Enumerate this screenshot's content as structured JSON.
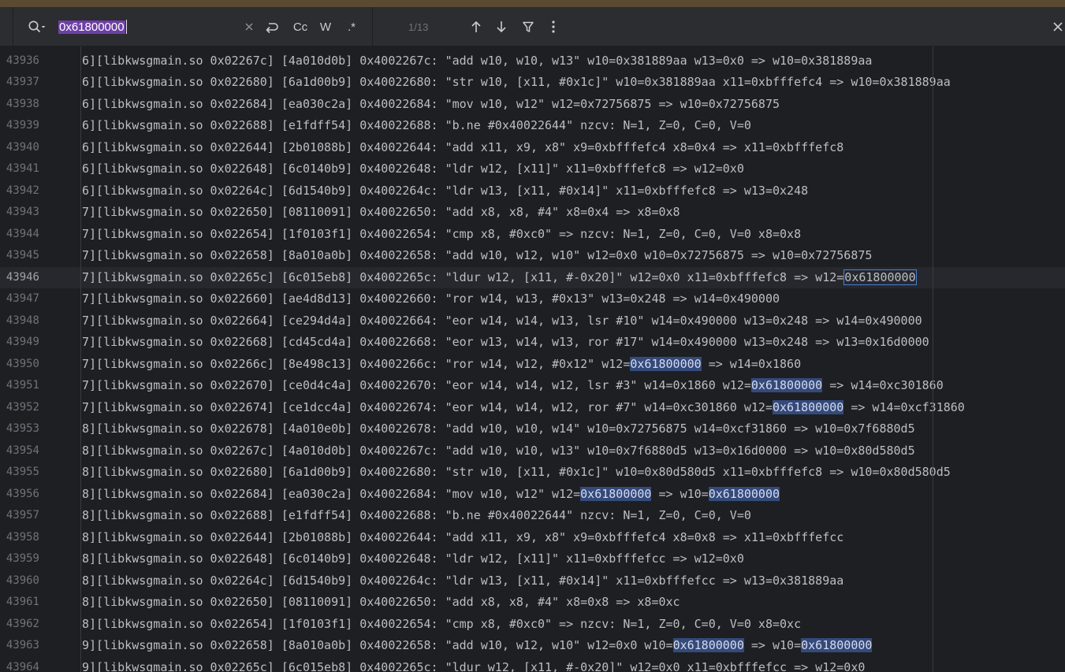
{
  "find_bar": {
    "search_value": "0x61800000",
    "options": {
      "match_case": "Cc",
      "words": "W",
      "regex": ".*"
    },
    "match_counter": "1/13",
    "icons": [
      "search-history-icon",
      "clear-icon",
      "newline-icon",
      "up-arrow-icon",
      "down-arrow-icon",
      "filter-icon",
      "more-options-icon",
      "close-icon"
    ]
  },
  "editor": {
    "current_line": "43946",
    "lines": [
      {
        "no": "43936",
        "segs": [
          {
            "t": "6][libkwsgmain.so 0x02267c] [4a010d0b] 0x4002267c: \"add w10, w10, w13\" w10=0x381889aa w13=0x0 => w10=0x381889aa"
          }
        ]
      },
      {
        "no": "43937",
        "segs": [
          {
            "t": "6][libkwsgmain.so 0x022680] [6a1d00b9] 0x40022680: \"str w10, [x11, #0x1c]\" w10=0x381889aa x11=0xbfffefc4 => w10=0x381889aa"
          }
        ]
      },
      {
        "no": "43938",
        "segs": [
          {
            "t": "6][libkwsgmain.so 0x022684] [ea030c2a] 0x40022684: \"mov w10, w12\" w12=0x72756875 => w10=0x72756875"
          }
        ]
      },
      {
        "no": "43939",
        "segs": [
          {
            "t": "6][libkwsgmain.so 0x022688] [e1fdff54] 0x40022688: \"b.ne #0x40022644\" nzcv: N=1, Z=0, C=0, V=0"
          }
        ]
      },
      {
        "no": "43940",
        "segs": [
          {
            "t": "6][libkwsgmain.so 0x022644] [2b01088b] 0x40022644: \"add x11, x9, x8\" x9=0xbfffefc4 x8=0x4 => x11=0xbfffefc8"
          }
        ]
      },
      {
        "no": "43941",
        "segs": [
          {
            "t": "6][libkwsgmain.so 0x022648] [6c0140b9] 0x40022648: \"ldr w12, [x11]\" x11=0xbfffefc8 => w12=0x0"
          }
        ]
      },
      {
        "no": "43942",
        "segs": [
          {
            "t": "6][libkwsgmain.so 0x02264c] [6d1540b9] 0x4002264c: \"ldr w13, [x11, #0x14]\" x11=0xbfffefc8 => w13=0x248"
          }
        ]
      },
      {
        "no": "43943",
        "segs": [
          {
            "t": "7][libkwsgmain.so 0x022650] [08110091] 0x40022650: \"add x8, x8, #4\" x8=0x4 => x8=0x8"
          }
        ]
      },
      {
        "no": "43944",
        "segs": [
          {
            "t": "7][libkwsgmain.so 0x022654] [1f0103f1] 0x40022654: \"cmp x8, #0xc0\" => nzcv: N=1, Z=0, C=0, V=0 x8=0x8"
          }
        ]
      },
      {
        "no": "43945",
        "segs": [
          {
            "t": "7][libkwsgmain.so 0x022658] [8a010a0b] 0x40022658: \"add w10, w12, w10\" w12=0x0 w10=0x72756875 => w10=0x72756875"
          }
        ]
      },
      {
        "no": "43946",
        "segs": [
          {
            "t": "7][libkwsgmain.so 0x02265c] [6c015eb8] 0x4002265c: \"ldur w12, [x11, #-0x20]\" w12=0x0 x11=0xbfffefc8 => w12="
          },
          {
            "t": "0x61800000",
            "h": "active"
          }
        ]
      },
      {
        "no": "43947",
        "segs": [
          {
            "t": "7][libkwsgmain.so 0x022660] [ae4d8d13] 0x40022660: \"ror w14, w13, #0x13\" w13=0x248 => w14=0x490000"
          }
        ]
      },
      {
        "no": "43948",
        "segs": [
          {
            "t": "7][libkwsgmain.so 0x022664] [ce294d4a] 0x40022664: \"eor w14, w14, w13, lsr #10\" w14=0x490000 w13=0x248 => w14=0x490000"
          }
        ]
      },
      {
        "no": "43949",
        "segs": [
          {
            "t": "7][libkwsgmain.so 0x022668] [cd45cd4a] 0x40022668: \"eor w13, w14, w13, ror #17\" w14=0x490000 w13=0x248 => w13=0x16d0000"
          }
        ]
      },
      {
        "no": "43950",
        "segs": [
          {
            "t": "7][libkwsgmain.so 0x02266c] [8e498c13] 0x4002266c: \"ror w14, w12, #0x12\" w12="
          },
          {
            "t": "0x61800000",
            "h": "match"
          },
          {
            "t": " => w14=0x1860"
          }
        ]
      },
      {
        "no": "43951",
        "segs": [
          {
            "t": "7][libkwsgmain.so 0x022670] [ce0d4c4a] 0x40022670: \"eor w14, w14, w12, lsr #3\" w14=0x1860 w12="
          },
          {
            "t": "0x61800000",
            "h": "match"
          },
          {
            "t": " => w14=0xc301860"
          }
        ]
      },
      {
        "no": "43952",
        "segs": [
          {
            "t": "7][libkwsgmain.so 0x022674] [ce1dcc4a] 0x40022674: \"eor w14, w14, w12, ror #7\" w14=0xc301860 w12="
          },
          {
            "t": "0x61800000",
            "h": "match"
          },
          {
            "t": " => w14=0xcf31860"
          }
        ]
      },
      {
        "no": "43953",
        "segs": [
          {
            "t": "8][libkwsgmain.so 0x022678] [4a010e0b] 0x40022678: \"add w10, w10, w14\" w10=0x72756875 w14=0xcf31860 => w10=0x7f6880d5"
          }
        ]
      },
      {
        "no": "43954",
        "segs": [
          {
            "t": "8][libkwsgmain.so 0x02267c] [4a010d0b] 0x4002267c: \"add w10, w10, w13\" w10=0x7f6880d5 w13=0x16d0000 => w10=0x80d580d5"
          }
        ]
      },
      {
        "no": "43955",
        "segs": [
          {
            "t": "8][libkwsgmain.so 0x022680] [6a1d00b9] 0x40022680: \"str w10, [x11, #0x1c]\" w10=0x80d580d5 x11=0xbfffefc8 => w10=0x80d580d5"
          }
        ]
      },
      {
        "no": "43956",
        "segs": [
          {
            "t": "8][libkwsgmain.so 0x022684] [ea030c2a] 0x40022684: \"mov w10, w12\" w12="
          },
          {
            "t": "0x61800000",
            "h": "match"
          },
          {
            "t": " => w10="
          },
          {
            "t": "0x61800000",
            "h": "match"
          }
        ]
      },
      {
        "no": "43957",
        "segs": [
          {
            "t": "8][libkwsgmain.so 0x022688] [e1fdff54] 0x40022688: \"b.ne #0x40022644\" nzcv: N=1, Z=0, C=0, V=0"
          }
        ]
      },
      {
        "no": "43958",
        "segs": [
          {
            "t": "8][libkwsgmain.so 0x022644] [2b01088b] 0x40022644: \"add x11, x9, x8\" x9=0xbfffefc4 x8=0x8 => x11=0xbfffefcc"
          }
        ]
      },
      {
        "no": "43959",
        "segs": [
          {
            "t": "8][libkwsgmain.so 0x022648] [6c0140b9] 0x40022648: \"ldr w12, [x11]\" x11=0xbfffefcc => w12=0x0"
          }
        ]
      },
      {
        "no": "43960",
        "segs": [
          {
            "t": "8][libkwsgmain.so 0x02264c] [6d1540b9] 0x4002264c: \"ldr w13, [x11, #0x14]\" x11=0xbfffefcc => w13=0x381889aa"
          }
        ]
      },
      {
        "no": "43961",
        "segs": [
          {
            "t": "8][libkwsgmain.so 0x022650] [08110091] 0x40022650: \"add x8, x8, #4\" x8=0x8 => x8=0xc"
          }
        ]
      },
      {
        "no": "43962",
        "segs": [
          {
            "t": "8][libkwsgmain.so 0x022654] [1f0103f1] 0x40022654: \"cmp x8, #0xc0\" => nzcv: N=1, Z=0, C=0, V=0 x8=0xc"
          }
        ]
      },
      {
        "no": "43963",
        "segs": [
          {
            "t": "9][libkwsgmain.so 0x022658] [8a010a0b] 0x40022658: \"add w10, w12, w10\" w12=0x0 w10="
          },
          {
            "t": "0x61800000",
            "h": "match"
          },
          {
            "t": " => w10="
          },
          {
            "t": "0x61800000",
            "h": "match"
          }
        ]
      },
      {
        "no": "43964",
        "segs": [
          {
            "t": "9][libkwsgmain.so 0x02265c] [6c015eb8] 0x4002265c: \"ldur w12, [x11, #-0x20]\" w12=0x0 x11=0xbfffefcc => w12=0x0"
          }
        ]
      }
    ]
  },
  "colors": {
    "background": "#1e1f22",
    "findbar": "#2b2d30",
    "match_highlight": "#344a7a",
    "active_match_border": "#4d7fd1",
    "selection": "#6e3fa6"
  }
}
